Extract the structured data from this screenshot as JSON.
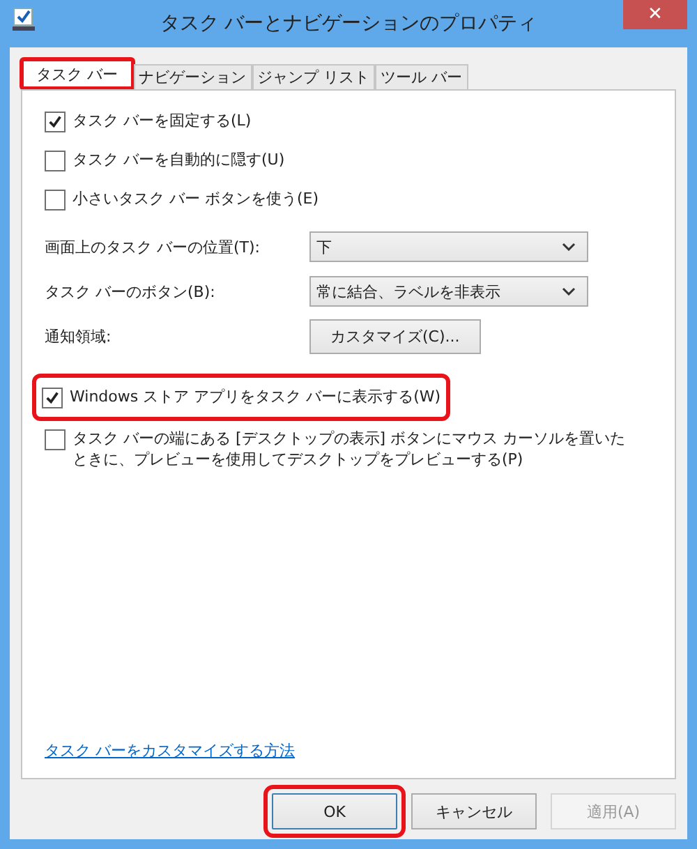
{
  "window": {
    "title": "タスク バーとナビゲーションのプロパティ",
    "close": "✕"
  },
  "tabs": [
    {
      "label": "タスク バー",
      "selected": true,
      "highlighted": true
    },
    {
      "label": "ナビゲーション",
      "selected": false,
      "highlighted": false
    },
    {
      "label": "ジャンプ リスト",
      "selected": false,
      "highlighted": false
    },
    {
      "label": "ツール バー",
      "selected": false,
      "highlighted": false
    }
  ],
  "options_top": [
    {
      "label": "タスク バーを固定する(L)",
      "checked": true
    },
    {
      "label": "タスク バーを自動的に隠す(U)",
      "checked": false
    },
    {
      "label": "小さいタスク バー ボタンを使う(E)",
      "checked": false
    }
  ],
  "settings": [
    {
      "kind": "dropdown",
      "label": "画面上のタスク バーの位置(T):",
      "value": "下"
    },
    {
      "kind": "dropdown",
      "label": "タスク バーのボタン(B):",
      "value": "常に結合、ラベルを非表示"
    },
    {
      "kind": "button",
      "label": "通知領域:",
      "value": "カスタマイズ(C)..."
    }
  ],
  "options_bottom": [
    {
      "label": "Windows ストア アプリをタスク バーに表示する(W)",
      "checked": true,
      "highlighted": true
    },
    {
      "label": "タスク バーの端にある [デスクトップの表示] ボタンにマウス カーソルを置いたときに、プレビューを使用してデスクトップをプレビューする(P)",
      "checked": false,
      "highlighted": false
    }
  ],
  "help_link": "タスク バーをカスタマイズする方法",
  "buttons": [
    {
      "label": "OK",
      "disabled": false,
      "highlighted": true,
      "default": true
    },
    {
      "label": "キャンセル",
      "disabled": false,
      "highlighted": false,
      "default": false
    },
    {
      "label": "適用(A)",
      "disabled": true,
      "highlighted": false,
      "default": false
    }
  ]
}
